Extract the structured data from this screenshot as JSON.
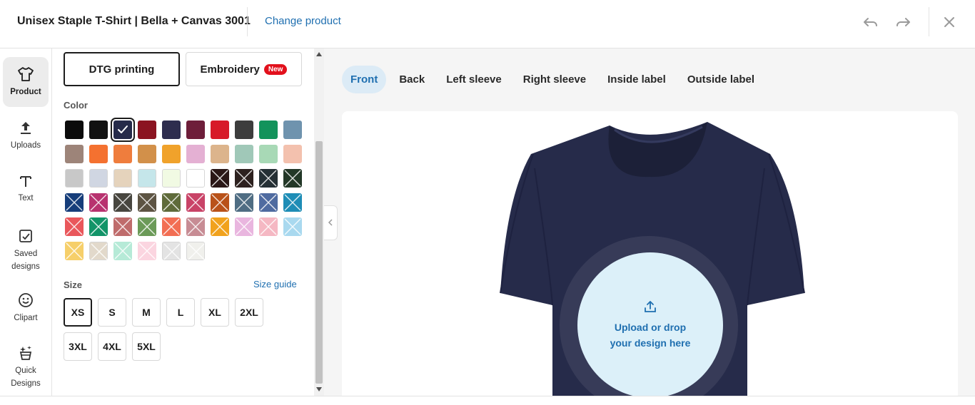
{
  "header": {
    "product_title": "Unisex Staple T-Shirt | Bella + Canvas 3001",
    "change_product": "Change product",
    "icons": [
      "undo-icon",
      "redo-icon",
      "close-icon"
    ]
  },
  "nav": {
    "items": [
      {
        "label": "Product",
        "icon": "tshirt-icon",
        "active": true
      },
      {
        "label": "Uploads",
        "icon": "upload-icon"
      },
      {
        "label": "Text",
        "icon": "text-icon"
      },
      {
        "label": "Saved designs",
        "icon": "saved-designs-icon"
      },
      {
        "label": "Clipart",
        "icon": "smiley-icon"
      },
      {
        "label": "Quick Designs",
        "icon": "quick-designs-icon"
      }
    ]
  },
  "panel": {
    "technique": {
      "dtg": "DTG printing",
      "embroidery": "Embroidery",
      "new_badge": "New"
    },
    "color_label": "Color",
    "colors": [
      {
        "hex": "#0b0b0b"
      },
      {
        "hex": "#111111"
      },
      {
        "hex": "#262b4a",
        "selected": true
      },
      {
        "hex": "#8b1421"
      },
      {
        "hex": "#2e2d4e"
      },
      {
        "hex": "#6e1e3a"
      },
      {
        "hex": "#d71a28"
      },
      {
        "hex": "#3d3d3d"
      },
      {
        "hex": "#13935b"
      },
      {
        "hex": "#6f93ae"
      },
      {
        "hex": "#9d8479"
      },
      {
        "hex": "#f47130"
      },
      {
        "hex": "#ef7d3d"
      },
      {
        "hex": "#d2904a"
      },
      {
        "hex": "#f0a22b"
      },
      {
        "hex": "#e4b0d3"
      },
      {
        "hex": "#dcb48c"
      },
      {
        "hex": "#a0c8b8"
      },
      {
        "hex": "#a8d9b6"
      },
      {
        "hex": "#f3c1ae"
      },
      {
        "hex": "#c8c8c8"
      },
      {
        "hex": "#d0d6e2"
      },
      {
        "hex": "#e5d3bc"
      },
      {
        "hex": "#c5e6ea"
      },
      {
        "hex": "#f1fae3"
      },
      {
        "hex": "#ffffff"
      },
      {
        "hex": "#2a1716",
        "x": true
      },
      {
        "hex": "#2d211f",
        "x": true
      },
      {
        "hex": "#253035",
        "x": true
      },
      {
        "hex": "#233828",
        "x": true
      },
      {
        "hex": "#163d7a",
        "x": true
      },
      {
        "hex": "#b8326f",
        "x": true
      },
      {
        "hex": "#48463f",
        "x": true
      },
      {
        "hex": "#5d5443",
        "x": true
      },
      {
        "hex": "#5f6b3a",
        "x": true
      },
      {
        "hex": "#c94367",
        "x": true
      },
      {
        "hex": "#b9521a",
        "x": true
      },
      {
        "hex": "#4f6d83",
        "x": true
      },
      {
        "hex": "#4f6ba0",
        "x": true
      },
      {
        "hex": "#1e8db6",
        "x": true
      },
      {
        "hex": "#e9575b",
        "x": true
      },
      {
        "hex": "#129468",
        "x": true
      },
      {
        "hex": "#bf6c6c",
        "x": true
      },
      {
        "hex": "#6b9a58",
        "x": true
      },
      {
        "hex": "#f26e53",
        "x": true
      },
      {
        "hex": "#c78c94",
        "x": true
      },
      {
        "hex": "#f1a21d",
        "x": true
      },
      {
        "hex": "#e9b6df",
        "x": true
      },
      {
        "hex": "#f5b8c3",
        "x": true
      },
      {
        "hex": "#a9d9ef",
        "x": true
      },
      {
        "hex": "#f6cf6a",
        "x": true
      },
      {
        "hex": "#e2d9cb",
        "x": true
      },
      {
        "hex": "#b6ead7",
        "x": true
      },
      {
        "hex": "#fbd5e0",
        "x": true
      },
      {
        "hex": "#e3e3e3",
        "x": true
      },
      {
        "hex": "#f0f0ec",
        "x": true
      }
    ],
    "size_label": "Size",
    "size_guide": "Size guide",
    "sizes": [
      {
        "label": "XS",
        "selected": true
      },
      {
        "label": "S"
      },
      {
        "label": "M"
      },
      {
        "label": "L"
      },
      {
        "label": "XL"
      },
      {
        "label": "2XL"
      },
      {
        "label": "3XL"
      },
      {
        "label": "4XL"
      },
      {
        "label": "5XL"
      }
    ]
  },
  "canvas": {
    "tabs": [
      {
        "label": "Front",
        "active": true
      },
      {
        "label": "Back"
      },
      {
        "label": "Left sleeve"
      },
      {
        "label": "Right sleeve"
      },
      {
        "label": "Inside label"
      },
      {
        "label": "Outside label"
      }
    ],
    "shirt_color": "#262b4a",
    "upload_line1": "Upload or drop",
    "upload_line2": "your design here"
  }
}
